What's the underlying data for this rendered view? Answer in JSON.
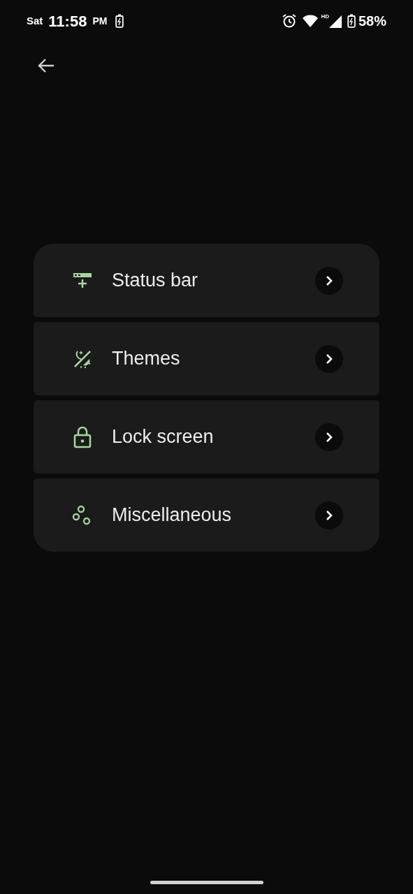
{
  "status_bar": {
    "day": "Sat",
    "time": "11:58",
    "ampm": "PM",
    "network": "HD",
    "battery": "58%"
  },
  "items": [
    {
      "kind": "status_bar",
      "label": "Status bar"
    },
    {
      "kind": "themes",
      "label": "Themes"
    },
    {
      "kind": "lock",
      "label": "Lock screen"
    },
    {
      "kind": "misc",
      "label": "Miscellaneous"
    }
  ]
}
